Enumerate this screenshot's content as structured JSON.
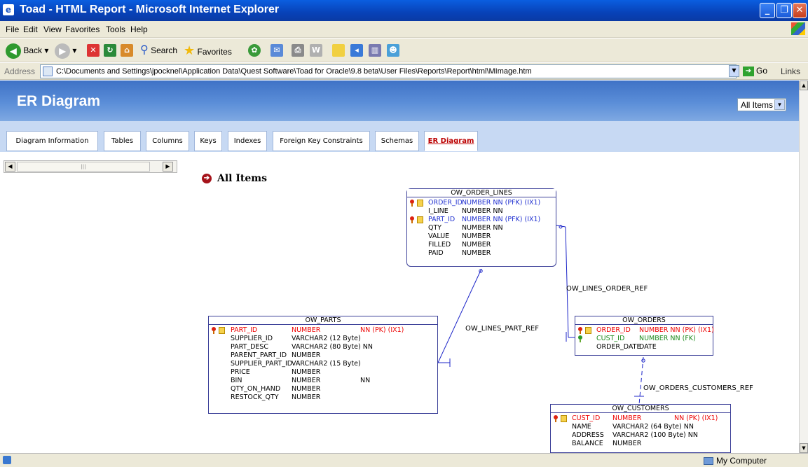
{
  "window": {
    "title": "Toad - HTML Report - Microsoft Internet Explorer"
  },
  "menu": [
    "File",
    "Edit",
    "View",
    "Favorites",
    "Tools",
    "Help"
  ],
  "toolbar": {
    "back": "Back",
    "search": "Search",
    "favorites": "Favorites"
  },
  "address": {
    "label": "Address",
    "url": "C:\\Documents and Settings\\jpocknel\\Application Data\\Quest Software\\Toad for Oracle\\9.8 beta\\User Files\\Reports\\Report\\html\\MImage.htm",
    "go": "Go",
    "links": "Links"
  },
  "page": {
    "title": "ER Diagram",
    "filter_value": "All Items",
    "section_title": "All Items"
  },
  "tabs": [
    "Diagram Information",
    "Tables",
    "Columns",
    "Keys",
    "Indexes",
    "Foreign Key Constraints",
    "Schemas",
    "ER Diagram"
  ],
  "status": {
    "zone": "My Computer"
  },
  "entities": {
    "order_lines": {
      "name": "OW_ORDER_LINES",
      "rows": [
        [
          "ORDER_ID",
          "NUMBER NN (PFK)  (IX1)"
        ],
        [
          "I_LINE",
          "NUMBER NN"
        ],
        [
          "PART_ID",
          "NUMBER NN (PFK)  (IX1)"
        ],
        [
          "QTY",
          "NUMBER NN"
        ],
        [
          "VALUE",
          "NUMBER"
        ],
        [
          "FILLED",
          "NUMBER"
        ],
        [
          "PAID",
          "NUMBER"
        ]
      ]
    },
    "parts": {
      "name": "OW_PARTS",
      "rows": [
        [
          "PART_ID",
          "NUMBER",
          "NN (PK)  (IX1)"
        ],
        [
          "SUPPLIER_ID",
          "VARCHAR2 (12 Byte)",
          ""
        ],
        [
          "PART_DESC",
          "VARCHAR2 (80 Byte)  NN",
          ""
        ],
        [
          "PARENT_PART_ID",
          "NUMBER",
          ""
        ],
        [
          "SUPPLIER_PART_ID",
          "VARCHAR2 (15 Byte)",
          ""
        ],
        [
          "PRICE",
          "NUMBER",
          ""
        ],
        [
          "BIN",
          "NUMBER",
          "NN"
        ],
        [
          "QTY_ON_HAND",
          "NUMBER",
          ""
        ],
        [
          "RESTOCK_QTY",
          "NUMBER",
          ""
        ]
      ]
    },
    "orders": {
      "name": "OW_ORDERS",
      "rows": [
        [
          "ORDER_ID",
          "NUMBER NN (PK)  (IX1)"
        ],
        [
          "CUST_ID",
          "NUMBER NN (FK)"
        ],
        [
          "ORDER_DATE",
          "DATE"
        ]
      ]
    },
    "customers": {
      "name": "OW_CUSTOMERS",
      "rows": [
        [
          "CUST_ID",
          "NUMBER",
          "NN (PK)  (IX1)"
        ],
        [
          "NAME",
          "VARCHAR2 (64 Byte)  NN",
          ""
        ],
        [
          "ADDRESS",
          "VARCHAR2 (100 Byte)  NN",
          ""
        ],
        [
          "BALANCE",
          "NUMBER",
          ""
        ]
      ]
    }
  },
  "relations": {
    "lines_order": "OW_LINES_ORDER_REF",
    "lines_part": "OW_LINES_PART_REF",
    "orders_customers": "OW_ORDERS_CUSTOMERS_REF"
  }
}
